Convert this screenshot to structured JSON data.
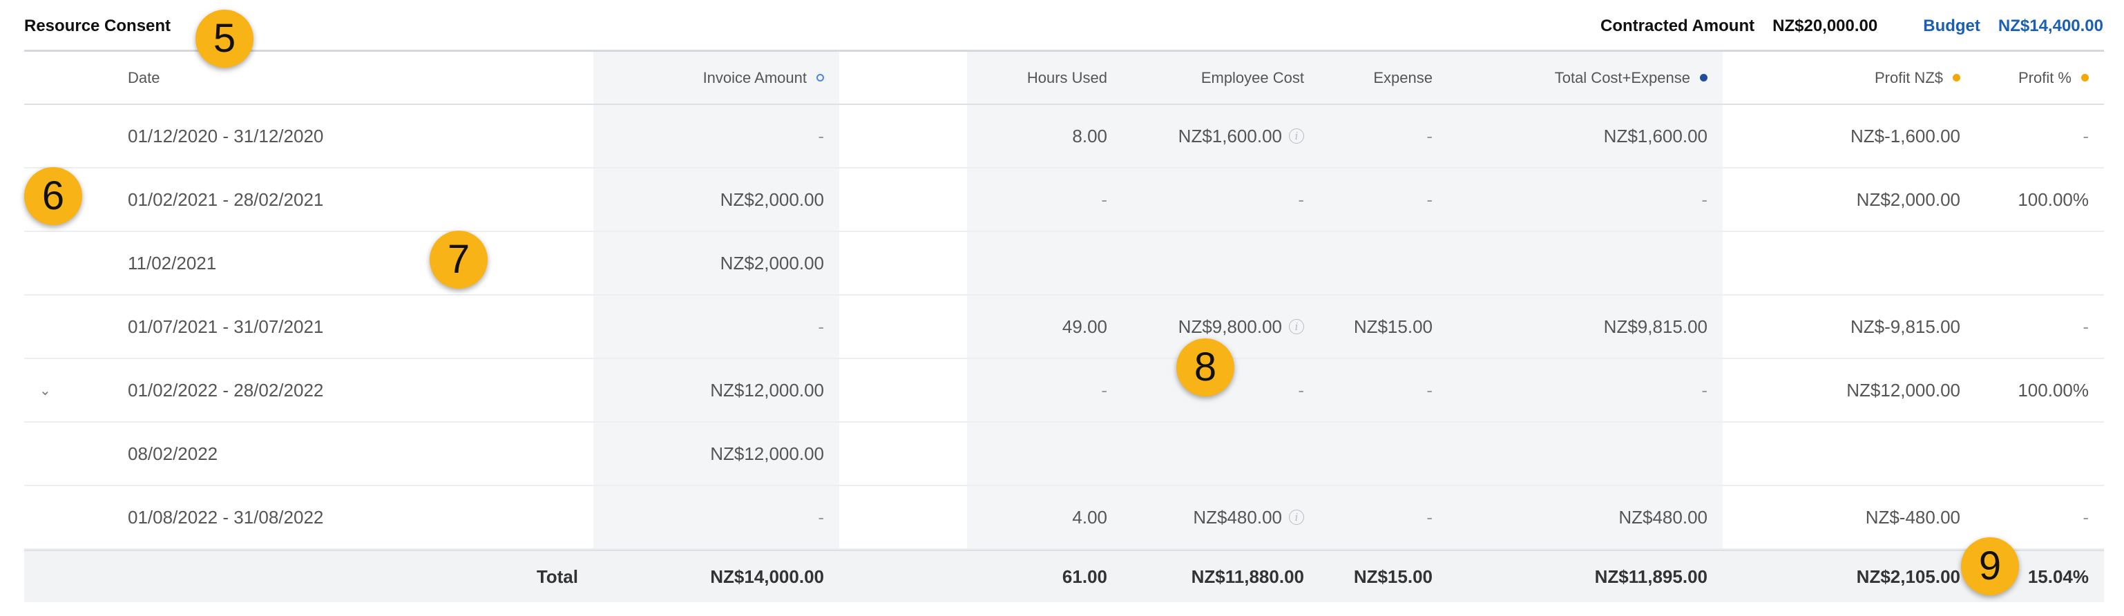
{
  "header": {
    "title": "Resource Consent",
    "contracted_label": "Contracted Amount",
    "contracted_value": "NZ$20,000.00",
    "budget_label": "Budget",
    "budget_value": "NZ$14,400.00"
  },
  "columns": [
    "Date",
    "Invoice Amount",
    "Hours Used",
    "Employee Cost",
    "Expense",
    "Total Cost+Expense",
    "Profit NZ$",
    "Profit %"
  ],
  "legend_dots": {
    "invoice": "#4a86e8",
    "total_cost": "#1f4e9c",
    "profit": "#f5a800"
  },
  "rows": [
    {
      "date": "01/12/2020 - 31/12/2020",
      "invoice": "-",
      "hours": "8.00",
      "employee_cost": "NZ$1,600.00",
      "expense": "-",
      "total": "NZ$1,600.00",
      "profit": "NZ$-1,600.00",
      "profit_pct": "-"
    },
    {
      "date": "01/02/2021 - 28/02/2021",
      "invoice": "NZ$2,000.00",
      "hours": "-",
      "employee_cost": "-",
      "expense": "-",
      "total": "-",
      "profit": "NZ$2,000.00",
      "profit_pct": "100.00%"
    },
    {
      "date": "11/02/2021",
      "invoice": "NZ$2,000.00"
    },
    {
      "date": "01/07/2021 - 31/07/2021",
      "invoice": "-",
      "hours": "49.00",
      "employee_cost": "NZ$9,800.00",
      "expense": "NZ$15.00",
      "total": "NZ$9,815.00",
      "profit": "NZ$-9,815.00",
      "profit_pct": "-"
    },
    {
      "date": "01/02/2022 - 28/02/2022",
      "invoice": "NZ$12,000.00",
      "hours": "-",
      "employee_cost": "-",
      "expense": "-",
      "total": "-",
      "profit": "NZ$12,000.00",
      "profit_pct": "100.00%"
    },
    {
      "date": "08/02/2022",
      "invoice": "NZ$12,000.00"
    },
    {
      "date": "01/08/2022 - 31/08/2022",
      "invoice": "-",
      "hours": "4.00",
      "employee_cost": "NZ$480.00",
      "expense": "-",
      "total": "NZ$480.00",
      "profit": "NZ$-480.00",
      "profit_pct": "-"
    }
  ],
  "total": {
    "label": "Total",
    "invoice": "NZ$14,000.00",
    "hours": "61.00",
    "employee_cost": "NZ$11,880.00",
    "expense": "NZ$15.00",
    "total": "NZ$11,895.00",
    "profit": "NZ$2,105.00",
    "profit_pct": "15.04%"
  },
  "badges": [
    "5",
    "6",
    "7",
    "8",
    "9"
  ],
  "icons": {
    "info": "info-icon",
    "expand": "chevron-down-icon"
  },
  "info_glyph": "i",
  "chevron_glyph": "⌄"
}
